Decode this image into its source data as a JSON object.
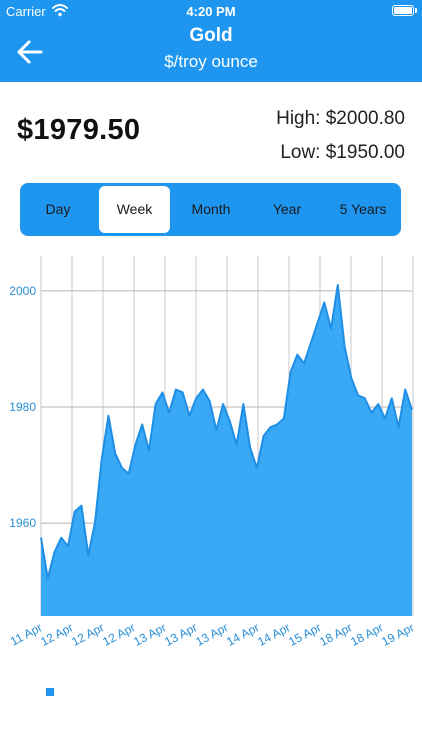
{
  "status": {
    "carrier": "Carrier",
    "time": "4:20 PM"
  },
  "header": {
    "title": "Gold",
    "subtitle": "$/troy ounce"
  },
  "summary": {
    "price": "$1979.50",
    "high": "High: $2000.80",
    "low": "Low: $1950.00"
  },
  "tabs": [
    {
      "label": "Day",
      "active": false
    },
    {
      "label": "Week",
      "active": true
    },
    {
      "label": "Month",
      "active": false
    },
    {
      "label": "Year",
      "active": false
    },
    {
      "label": "5 Years",
      "active": false
    }
  ],
  "colors": {
    "accent": "#1e96f0",
    "area_fill": "#39a8f5",
    "line": "#1e8ee6"
  },
  "chart_data": {
    "type": "area",
    "title": "",
    "xlabel": "",
    "ylabel": "",
    "ylim": [
      1944,
      2006
    ],
    "y_ticks": [
      1960,
      1980,
      2000
    ],
    "x_ticks": [
      "11 Apr",
      "12 Apr",
      "12 Apr",
      "12 Apr",
      "13 Apr",
      "13 Apr",
      "13 Apr",
      "14 Apr",
      "14 Apr",
      "15 Apr",
      "18 Apr",
      "18 Apr",
      "19 Apr"
    ],
    "grid": true,
    "values": [
      1957.5,
      1950.5,
      1955.0,
      1957.5,
      1956.0,
      1962.0,
      1963.0,
      1954.5,
      1960.0,
      1971.0,
      1978.5,
      1972.0,
      1969.5,
      1968.5,
      1973.5,
      1977.0,
      1972.5,
      1980.5,
      1982.5,
      1979.0,
      1983.0,
      1982.5,
      1978.5,
      1981.5,
      1983.0,
      1981.0,
      1976.0,
      1980.5,
      1977.5,
      1973.5,
      1980.5,
      1973.0,
      1969.5,
      1975.0,
      1976.5,
      1977.0,
      1978.0,
      1986.0,
      1989.0,
      1987.5,
      1991.0,
      1994.5,
      1998.0,
      1993.5,
      2001.0,
      1990.5,
      1985.0,
      1982.0,
      1981.5,
      1979.0,
      1980.5,
      1978.0,
      1981.5,
      1976.5,
      1983.0,
      1979.5
    ]
  }
}
